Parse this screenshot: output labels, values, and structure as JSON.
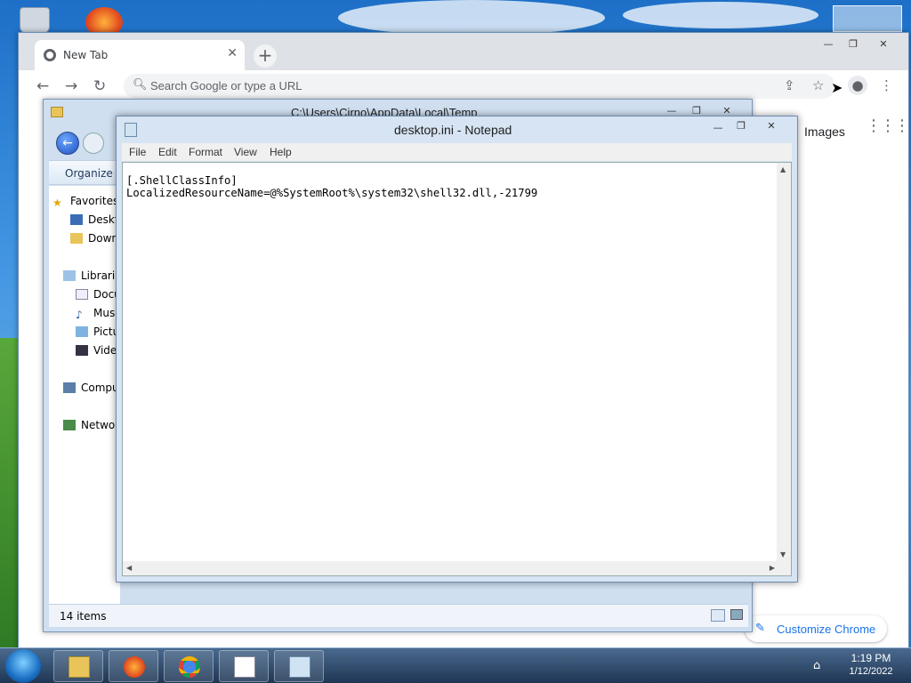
{
  "chrome": {
    "tab_title": "New Tab",
    "omnibox_placeholder": "Search Google or type a URL",
    "images_link": "Images",
    "customize_label": "Customize Chrome",
    "window_buttons": [
      "—",
      "❐",
      "✕"
    ]
  },
  "explorer": {
    "title": "C:\\Users\\Cirno\\AppData\\Local\\Temp",
    "organize": "Organize ▾",
    "nav": [
      {
        "label": "Favorites",
        "icon": "star-icon"
      },
      {
        "label": "Desktop",
        "icon": "desktop-icon"
      },
      {
        "label": "Downloads",
        "icon": "downloads-icon"
      },
      {
        "label": "Libraries",
        "icon": "library-icon"
      },
      {
        "label": "Documents",
        "icon": "document-icon"
      },
      {
        "label": "Music",
        "icon": "music-icon"
      },
      {
        "label": "Pictures",
        "icon": "pictures-icon"
      },
      {
        "label": "Videos",
        "icon": "video-icon"
      },
      {
        "label": "Computer",
        "icon": "computer-icon"
      },
      {
        "label": "Network",
        "icon": "network-icon"
      }
    ],
    "status": "14 items"
  },
  "notepad": {
    "title": "desktop.ini - Notepad",
    "menu": [
      "File",
      "Edit",
      "Format",
      "View",
      "Help"
    ],
    "content": "[.ShellClassInfo]\nLocalizedResourceName=@%SystemRoot%\\system32\\shell32.dll,-21799"
  },
  "taskbar": {
    "time": "1:19 PM",
    "date": "1/12/2022",
    "apps": [
      "explorer",
      "firefox",
      "chrome",
      "task-list",
      "notepad"
    ]
  },
  "colors": {
    "accent": "#1a73e8",
    "taskbar": "#1f3654"
  }
}
